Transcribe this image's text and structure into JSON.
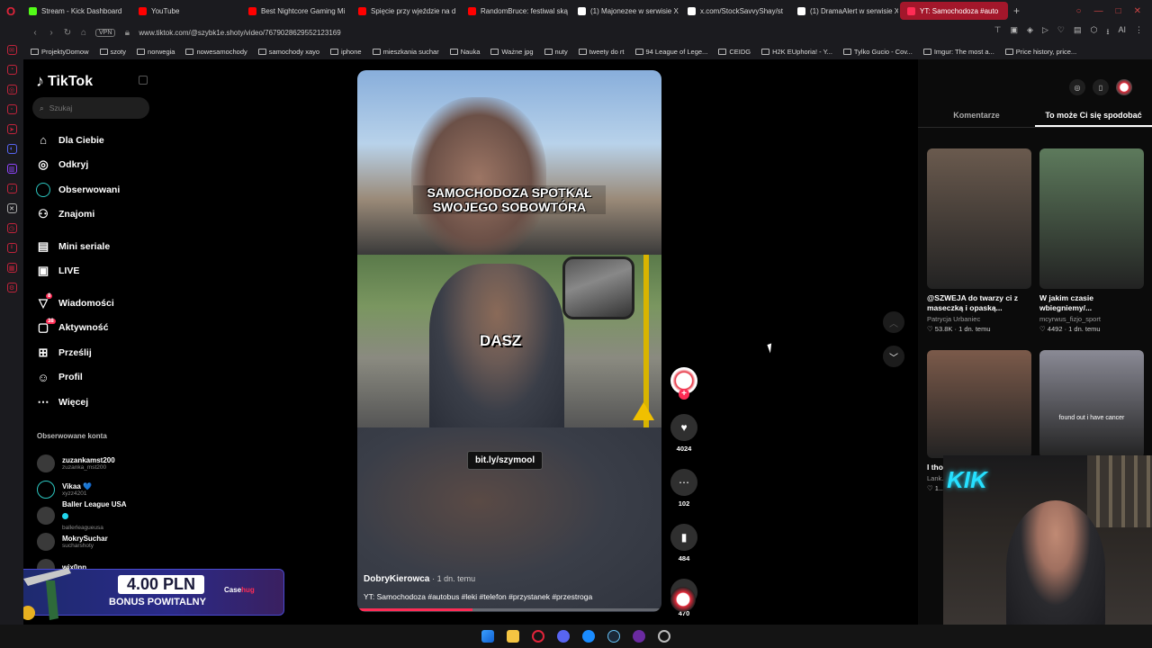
{
  "browser": {
    "tabs": [
      {
        "label": "Stream - Kick Dashboard",
        "color": "#53fc18"
      },
      {
        "label": "YouTube",
        "color": "#ff0000"
      },
      {
        "label": "Best Nightcore Gaming Mi",
        "color": "#ff0000"
      },
      {
        "label": "Spięcie przy wjeździe na d",
        "color": "#ff0000"
      },
      {
        "label": "RandomBruce: festiwal ską",
        "color": "#ff0000"
      },
      {
        "label": "(1) Majonezee w serwisie X",
        "color": "#ffffff"
      },
      {
        "label": "x.com/StockSavvyShay/st",
        "color": "#ffffff"
      },
      {
        "label": "(1) DramaAlert w serwisie X",
        "color": "#ffffff"
      },
      {
        "label": "YT: Samochodoza #auto",
        "color": "#fe2c55",
        "active": true
      }
    ],
    "vpn_label": "VPN",
    "url": "www.tiktok.com/@szybk1e.shoty/video/7679028629552123169",
    "ai_label": "AI",
    "bookmarks": [
      "ProjektyDomow",
      "szoty",
      "norwegia",
      "nowesamochody",
      "samochody xayo",
      "iphone",
      "mieszkania suchar",
      "Nauka",
      "Ważne jpg",
      "nuty",
      "tweety do rt",
      "94 League of Lege...",
      "CEIDG",
      "H2K EUphoria! - Y...",
      "Tylko Gucio - Cov...",
      "Imgur: The most a...",
      "Price history, price..."
    ]
  },
  "tiktok": {
    "logo": "TikTok",
    "search_placeholder": "Szukaj",
    "nav": {
      "for_you": "Dla Ciebie",
      "explore": "Odkryj",
      "following": "Obserwowani",
      "friends": "Znajomi",
      "mini_series": "Mini seriale",
      "live": "LIVE",
      "messages": "Wiadomości",
      "messages_badge": "8",
      "activity": "Aktywność",
      "activity_badge": "38",
      "upload": "Prześlij",
      "profile": "Profil",
      "more": "Więcej"
    },
    "following_title": "Obserwowane konta",
    "following_accounts": [
      {
        "name": "zuzankamst200",
        "handle": "zuzanka_mst200"
      },
      {
        "name": "Vikaa 💙",
        "handle": "xyzz4201"
      },
      {
        "name": "Baller League USA",
        "handle": "ballerleagueusa"
      },
      {
        "name": "MokrySuchar",
        "handle": "sucharshoty"
      },
      {
        "name": "wix0nn",
        "handle": ""
      }
    ]
  },
  "promo": {
    "amount": "4.00 PLN",
    "subtitle": "BONUS POWITALNY",
    "brand": "Case",
    "brand_suffix": "hug"
  },
  "video": {
    "overlay_caption": "SAMOCHODOZA SPOTKAŁ SWOJEGO SOBOWTÓRA",
    "mid_text": "DASZ",
    "link_sticker": "bit.ly/szymool",
    "author": "DobryKierowca",
    "date": "· 1 dn. temu",
    "description": "YT: Samochodoza #autobus #leki #telefon #przystanek #przestroga",
    "progress": 0.38
  },
  "actions": {
    "likes": "4024",
    "comments": "102",
    "saves": "484",
    "shares": "470"
  },
  "right_panel": {
    "tabs": [
      "Komentarze",
      "To może Ci się spodobać"
    ],
    "active_tab": 1,
    "cards": [
      {
        "title": "@SZWEJA do twarzy ci z maseczką i opaską...",
        "author": "Patrycja Urbaniec",
        "meta": "♡ 53.8K · 1 dn. temu",
        "color": "#6a5a4e"
      },
      {
        "title": "W jakim czasie wbiegniemy/...",
        "author": "mcyrwus_fizjo_sport",
        "meta": "♡ 4492 · 1 dn. temu",
        "color": "#5d7a5c"
      },
      {
        "title": "I tho... sittir...",
        "author": "Lank...",
        "meta": "♡ 1...",
        "color": "#7b5a4a"
      },
      {
        "title": "",
        "author": "",
        "meta": "",
        "color": "#8a8a95",
        "overlay": "found out i have cancer"
      }
    ]
  },
  "webcam_logo": "KIK"
}
